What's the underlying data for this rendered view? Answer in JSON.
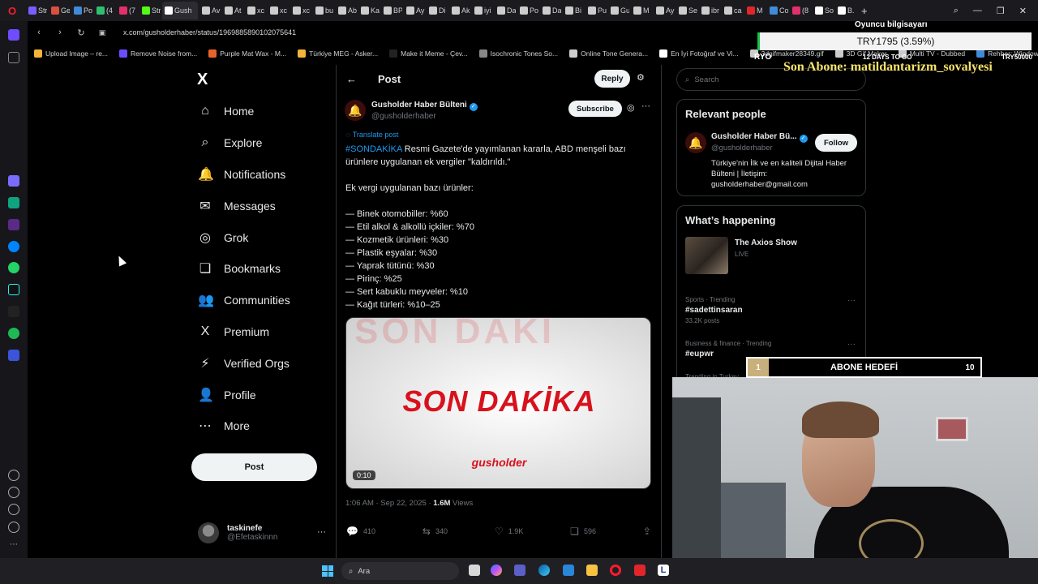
{
  "browser": {
    "tabs": [
      {
        "label": "Str",
        "color": "#7b5cff"
      },
      {
        "label": "Ge",
        "color": "#d9503f"
      },
      {
        "label": "Po",
        "color": "#3f8bd9"
      },
      {
        "label": "(4",
        "color": "#2fbf71"
      },
      {
        "label": "(7",
        "color": "#e1306c"
      },
      {
        "label": "Str",
        "color": "#53fc18"
      },
      {
        "label": "Gush",
        "color": "#ffffff"
      },
      {
        "label": "Av",
        "color": "#cccccc"
      },
      {
        "label": "At",
        "color": "#cccccc"
      },
      {
        "label": "xc",
        "color": "#cccccc"
      },
      {
        "label": "xc",
        "color": "#cccccc"
      },
      {
        "label": "xc",
        "color": "#cccccc"
      },
      {
        "label": "bu",
        "color": "#cccccc"
      },
      {
        "label": "Ab",
        "color": "#cccccc"
      },
      {
        "label": "Ka",
        "color": "#cccccc"
      },
      {
        "label": "BP",
        "color": "#cccccc"
      },
      {
        "label": "Ay",
        "color": "#cccccc"
      },
      {
        "label": "Di",
        "color": "#cccccc"
      },
      {
        "label": "Ak",
        "color": "#cccccc"
      },
      {
        "label": "iyi",
        "color": "#cccccc"
      },
      {
        "label": "Da",
        "color": "#cccccc"
      },
      {
        "label": "Po",
        "color": "#cccccc"
      },
      {
        "label": "Da",
        "color": "#cccccc"
      },
      {
        "label": "Bi",
        "color": "#cccccc"
      },
      {
        "label": "Pu",
        "color": "#cccccc"
      },
      {
        "label": "Gu",
        "color": "#cccccc"
      },
      {
        "label": "M",
        "color": "#cccccc"
      },
      {
        "label": "Ay",
        "color": "#cccccc"
      },
      {
        "label": "Se",
        "color": "#cccccc"
      },
      {
        "label": "ibr",
        "color": "#cccccc"
      },
      {
        "label": "ca",
        "color": "#cccccc"
      },
      {
        "label": "M",
        "color": "#e0262a"
      },
      {
        "label": "Co",
        "color": "#3f8bd9"
      },
      {
        "label": "(8",
        "color": "#e1306c"
      },
      {
        "label": "So",
        "color": "#ffffff"
      },
      {
        "label": "B.",
        "color": "#ffffff"
      }
    ],
    "new_tab": "+",
    "url": "x.com/gusholderhaber/status/1969885890102075641",
    "bookmarks": [
      {
        "label": "Upload Image – re...",
        "color": "#f3b43c"
      },
      {
        "label": "Remove Noise from...",
        "color": "#6b4cff"
      },
      {
        "label": "Purple Mat Wax - M...",
        "color": "#e8632b"
      },
      {
        "label": "Türkiye MEG - Asker...",
        "color": "#f3b43c"
      },
      {
        "label": "Make it Meme - Çev...",
        "color": "#222222"
      },
      {
        "label": "Isochronic Tones So...",
        "color": "#888888"
      },
      {
        "label": "Online Tone Genera...",
        "color": "#cccccc"
      },
      {
        "label": "En İyi Fotoğraf ve Vi...",
        "color": "#ffffff"
      },
      {
        "label": "3dgifmaker28349.gif",
        "color": "#cccccc"
      },
      {
        "label": "3D Gif Maker",
        "color": "#cccccc"
      },
      {
        "label": "Multi TV - Dubbed",
        "color": "#cccccc"
      },
      {
        "label": "Rehber: Windows 1...",
        "color": "#3f8bd9"
      }
    ]
  },
  "x": {
    "logo": "X",
    "nav": [
      {
        "icon": "⌂",
        "label": "Home"
      },
      {
        "icon": "⌕",
        "label": "Explore"
      },
      {
        "icon": "🔔",
        "label": "Notifications"
      },
      {
        "icon": "✉",
        "label": "Messages"
      },
      {
        "icon": "◎",
        "label": "Grok"
      },
      {
        "icon": "❏",
        "label": "Bookmarks"
      },
      {
        "icon": "👥",
        "label": "Communities"
      },
      {
        "icon": "X",
        "label": "Premium"
      },
      {
        "icon": "⚡",
        "label": "Verified Orgs"
      },
      {
        "icon": "👤",
        "label": "Profile"
      },
      {
        "icon": "⋯",
        "label": "More"
      }
    ],
    "post_button": "Post",
    "account": {
      "name": "taskinefe",
      "handle": "@Efetaskinnn",
      "more": "···"
    },
    "header": {
      "back": "←",
      "title": "Post",
      "reply": "Reply",
      "sliders": "⚙"
    },
    "post": {
      "author_name": "Gusholder Haber Bülteni",
      "author_handle": "@gusholderhaber",
      "subscribe": "Subscribe",
      "translate": "Translate post",
      "hashtag": "#SONDAKİKA",
      "text_after_hashtag": " Resmi Gazete'de yayımlanan kararla, ABD menşeli bazı ürünlere uygulanan ek vergiler \"kaldırıldı.\"",
      "body": "Ek vergi uygulanan bazı ürünler:\n\n— Binek otomobiller: %60\n— Etil alkol & alkollü içkiler: %70\n— Kozmetik ürünleri: %30\n— Plastik eşyalar: %30\n— Yaprak tütünü: %30\n— Pirinç: %25\n— Sert kabuklu meyveler: %10\n— Kağıt türleri: %10–25",
      "media_bg": "SON DAKI",
      "media_title": "SON DAKİKA",
      "media_logo": "gusholder",
      "duration": "0:10",
      "time": "1:06 AM · Sep 22, 2025 · ",
      "views_count": "1.6M",
      "views_label": " Views",
      "replies": "410",
      "reposts": "340",
      "likes": "1.9K",
      "bookmarks": "596"
    },
    "search_placeholder": "Search",
    "relevant": {
      "title": "Relevant people",
      "name": "Gusholder Haber Bü...",
      "handle": "@gusholderhaber",
      "follow": "Follow",
      "bio": "Türkiye'nin İlk ve en kaliteli Dijital Haber Bülteni | İletişim: gusholderhaber@gmail.com"
    },
    "happening": {
      "title": "What’s happening",
      "live_title": "The Axios Show",
      "live_label": "LIVE",
      "trends": [
        {
          "category": "Sports · Trending",
          "name": "#sadettinsaran",
          "count": "33.2K posts"
        },
        {
          "category": "Business & finance · Trending",
          "name": "#eupwr",
          "count": ""
        },
        {
          "category": "Trending in Turkey",
          "name": "",
          "count": ""
        }
      ]
    }
  },
  "overlay": {
    "title": "Oyuncu bilgisayarı",
    "price": "TRY1795 (3.59%)",
    "left_label": "RYO",
    "days_to_go": "12 DAYS TO GO",
    "right_label": "TRY50000",
    "subscriber": "Son Abone: matildantarizm_sovalyesi",
    "goal_current": "1",
    "goal_label": "ABONE HEDEFİ",
    "goal_target": "10",
    "goal_progress": 0.1
  },
  "taskbar": {
    "search_placeholder": "Ara"
  }
}
